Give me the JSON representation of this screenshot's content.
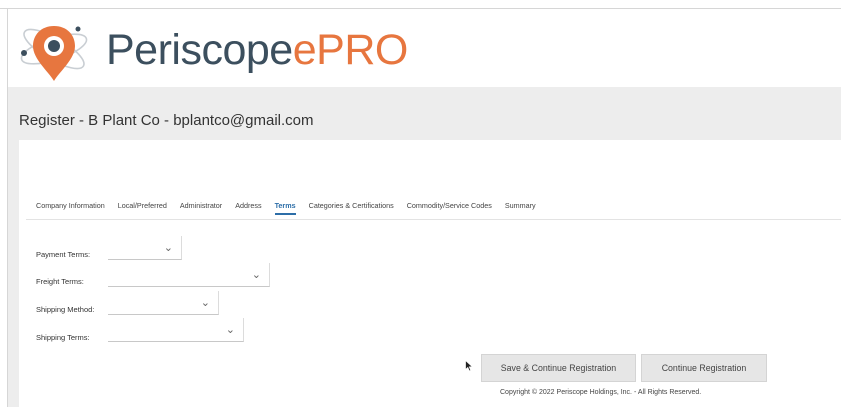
{
  "brand": {
    "name_part1": "Periscope",
    "name_part2": "ePRO"
  },
  "page": {
    "title": "Register - B Plant Co - bplantco@gmail.com"
  },
  "tabs": [
    {
      "label": "Company Information",
      "active": false
    },
    {
      "label": "Local/Preferred",
      "active": false
    },
    {
      "label": "Administrator",
      "active": false
    },
    {
      "label": "Address",
      "active": false
    },
    {
      "label": "Terms",
      "active": true
    },
    {
      "label": "Categories & Certifications",
      "active": false
    },
    {
      "label": "Commodity/Service Codes",
      "active": false
    },
    {
      "label": "Summary",
      "active": false
    }
  ],
  "form": {
    "payment_terms": {
      "label": "Payment Terms:",
      "value": ""
    },
    "freight_terms": {
      "label": "Freight Terms:",
      "value": ""
    },
    "shipping_method": {
      "label": "Shipping Method:",
      "value": ""
    },
    "shipping_terms": {
      "label": "Shipping Terms:",
      "value": ""
    }
  },
  "actions": {
    "save_continue": "Save & Continue Registration",
    "continue": "Continue Registration"
  },
  "footer": {
    "copyright": "Copyright © 2022 Periscope Holdings, Inc. - All Rights Reserved."
  },
  "icons": {
    "select_chevron": "chevron-down-icon",
    "cursor": "mouse-cursor-icon"
  },
  "colors": {
    "brand_dark": "#3c4f5e",
    "brand_accent": "#e7763f",
    "active_tab": "#2d6ea8"
  }
}
